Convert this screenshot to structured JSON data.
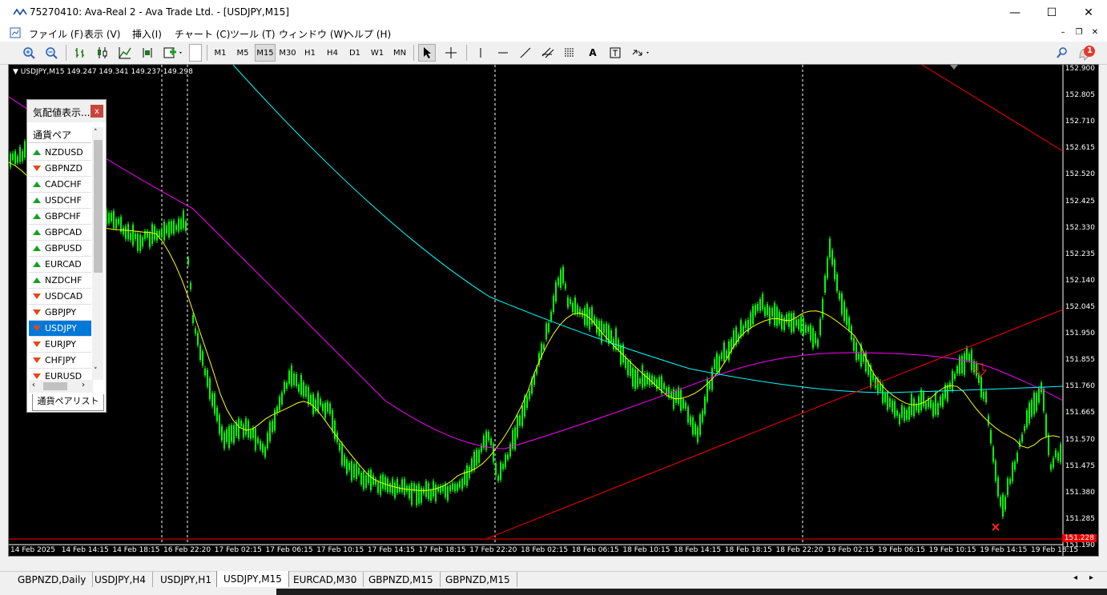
{
  "window": {
    "title": "75270410: Ava-Real 2 - Ava Trade Ltd. - [USDJPY,M15]",
    "minimize": "—",
    "maximize": "☐",
    "close": "✕"
  },
  "menu": [
    "ファイル (F)",
    "表示 (V)",
    "挿入(I)",
    "チャート (C)",
    "ツール (T)",
    "ウィンドウ (W)",
    "ヘルプ (H)"
  ],
  "timeframes": [
    "M1",
    "M5",
    "M15",
    "M30",
    "H1",
    "H4",
    "D1",
    "W1",
    "MN"
  ],
  "active_timeframe": "M15",
  "notification_count": "1",
  "chart": {
    "header": "USDJPY,M15  149.247 149.341 149.237 149.298",
    "current_price": "151.228",
    "price_labels": [
      "152.900",
      "152.805",
      "152.710",
      "152.615",
      "152.520",
      "152.425",
      "152.330",
      "152.235",
      "152.140",
      "152.045",
      "151.950",
      "151.855",
      "151.760",
      "151.665",
      "151.570",
      "151.475",
      "151.380",
      "151.285",
      "151.190"
    ],
    "time_labels": [
      "14 Feb 2025",
      "14 Feb 14:15",
      "14 Feb 18:15",
      "16 Feb 22:20",
      "17 Feb 02:15",
      "17 Feb 06:15",
      "17 Feb 10:15",
      "17 Feb 14:15",
      "17 Feb 18:15",
      "17 Feb 22:20",
      "18 Feb 02:15",
      "18 Feb 06:15",
      "18 Feb 10:15",
      "18 Feb 14:15",
      "18 Feb 18:15",
      "18 Feb 22:20",
      "19 Feb 02:15",
      "19 Feb 06:15",
      "19 Feb 10:15",
      "19 Feb 14:15",
      "19 Feb 18:15"
    ],
    "colors": {
      "candles": "#00ff00",
      "ma_yellow": "#ffff00",
      "ma_magenta": "#ff00ff",
      "ma_cyan": "#00ffff",
      "trend": "#ff0000"
    }
  },
  "market_watch": {
    "title": "気配値表示...",
    "close": "x",
    "column_header": "通貨ペア",
    "tab": "通貨ペアリスト",
    "rows": [
      {
        "symbol": "NZDUSD",
        "dir": "up"
      },
      {
        "symbol": "GBPNZD",
        "dir": "dn"
      },
      {
        "symbol": "CADCHF",
        "dir": "up"
      },
      {
        "symbol": "USDCHF",
        "dir": "up"
      },
      {
        "symbol": "GBPCHF",
        "dir": "up"
      },
      {
        "symbol": "GBPCAD",
        "dir": "up"
      },
      {
        "symbol": "GBPUSD",
        "dir": "up"
      },
      {
        "symbol": "EURCAD",
        "dir": "up"
      },
      {
        "symbol": "NZDCHF",
        "dir": "up"
      },
      {
        "symbol": "USDCAD",
        "dir": "dn"
      },
      {
        "symbol": "GBPJPY",
        "dir": "dn"
      },
      {
        "symbol": "USDJPY",
        "dir": "dn",
        "selected": true
      },
      {
        "symbol": "EURJPY",
        "dir": "dn"
      },
      {
        "symbol": "CHFJPY",
        "dir": "dn"
      },
      {
        "symbol": "EURUSD",
        "dir": "dn"
      }
    ]
  },
  "tabs": [
    "GBPNZD,Daily",
    "USDJPY,H4",
    "USDJPY,H1",
    "USDJPY,M15",
    "EURCAD,M30",
    "GBPNZD,M15",
    "GBPNZD,M15"
  ],
  "active_tab": "USDJPY,M15"
}
